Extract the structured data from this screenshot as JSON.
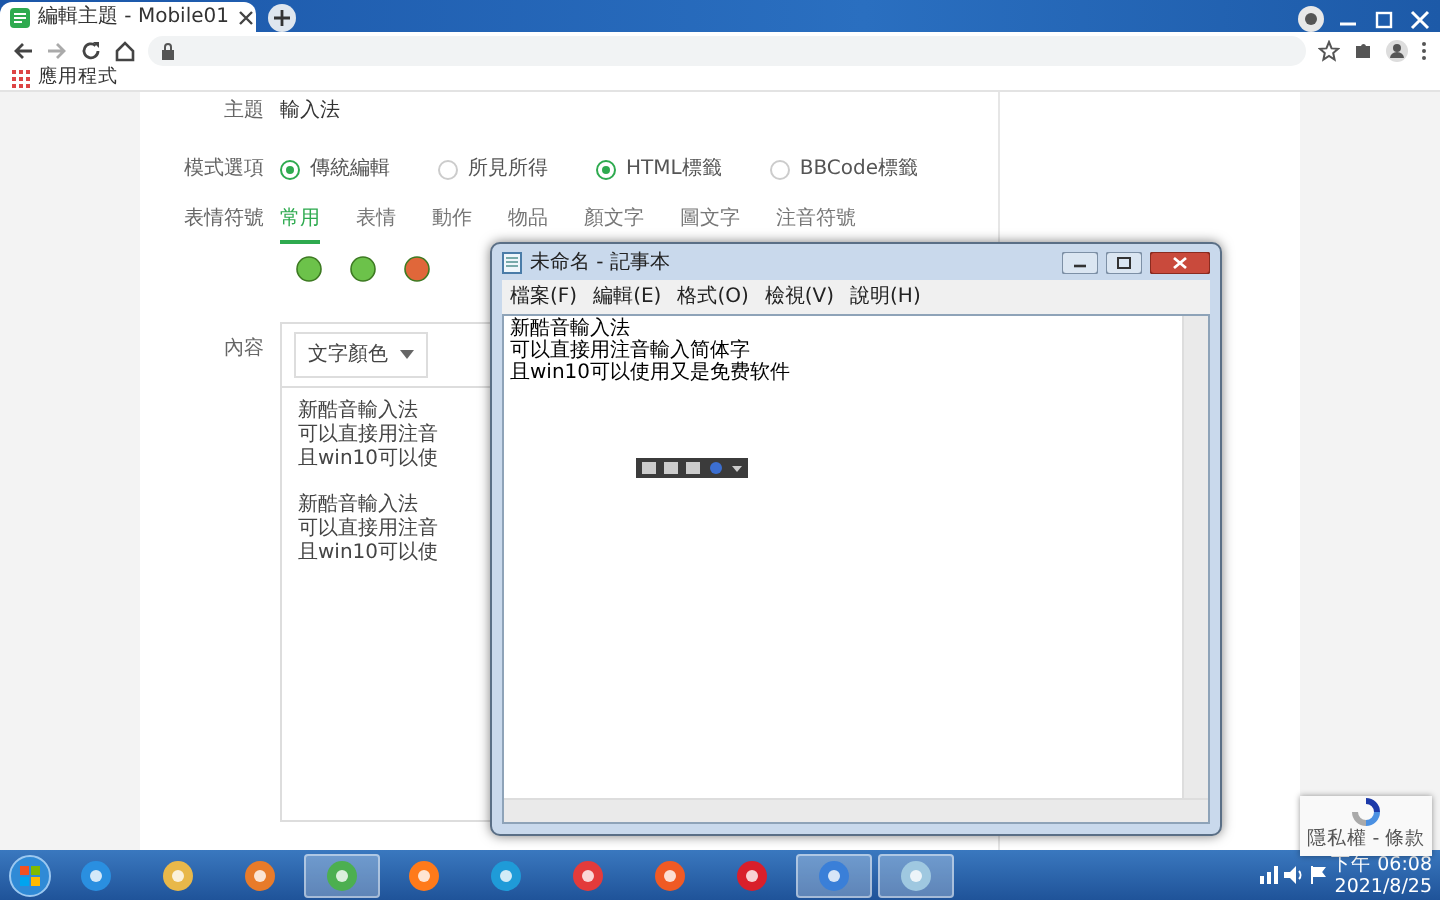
{
  "browser": {
    "tab_title": "編輯主題 - Mobile01",
    "bookmark": "應用程式"
  },
  "form": {
    "subject_label": "主題",
    "subject": "輸入法",
    "mode_label": "模式選項",
    "modes": [
      {
        "label": "傳統編輯",
        "selected": true
      },
      {
        "label": "所見所得",
        "selected": false
      },
      {
        "label": "HTML標籤",
        "selected": true
      },
      {
        "label": "BBCode標籤",
        "selected": false
      }
    ],
    "emoji_label": "表情符號",
    "emoji_tabs": [
      {
        "label": "常用",
        "selected": true
      },
      {
        "label": "表情",
        "selected": false
      },
      {
        "label": "動作",
        "selected": false
      },
      {
        "label": "物品",
        "selected": false
      },
      {
        "label": "顏文字",
        "selected": false
      },
      {
        "label": "圖文字",
        "selected": false
      },
      {
        "label": "注音符號",
        "selected": false
      }
    ],
    "content_label": "內容",
    "color_menu": "文字顏色",
    "content_paragraphs": [
      [
        "新酷音輸入法",
        "可以直接用注音",
        "且win10可以使"
      ],
      [
        "新酷音輸入法",
        "可以直接用注音",
        "且win10可以使"
      ]
    ]
  },
  "notepad": {
    "title": "未命名 - 記事本",
    "menu": [
      "檔案(F)",
      "編輯(E)",
      "格式(O)",
      "檢視(V)",
      "說明(H)"
    ],
    "lines": [
      "新酷音輸入法",
      "可以直接用注音輸入简体字",
      "且win10可以使用又是免费软件"
    ]
  },
  "recaptcha": {
    "text": "隱私權 - 條款"
  },
  "taskbar": {
    "apps": [
      {
        "active": false
      },
      {
        "active": false
      },
      {
        "active": false
      },
      {
        "active": true
      },
      {
        "active": false
      },
      {
        "active": false
      },
      {
        "active": false
      },
      {
        "active": false
      },
      {
        "active": false
      },
      {
        "active": true
      },
      {
        "active": true
      }
    ],
    "time": "下午 06:08",
    "date": "2021/8/25"
  }
}
